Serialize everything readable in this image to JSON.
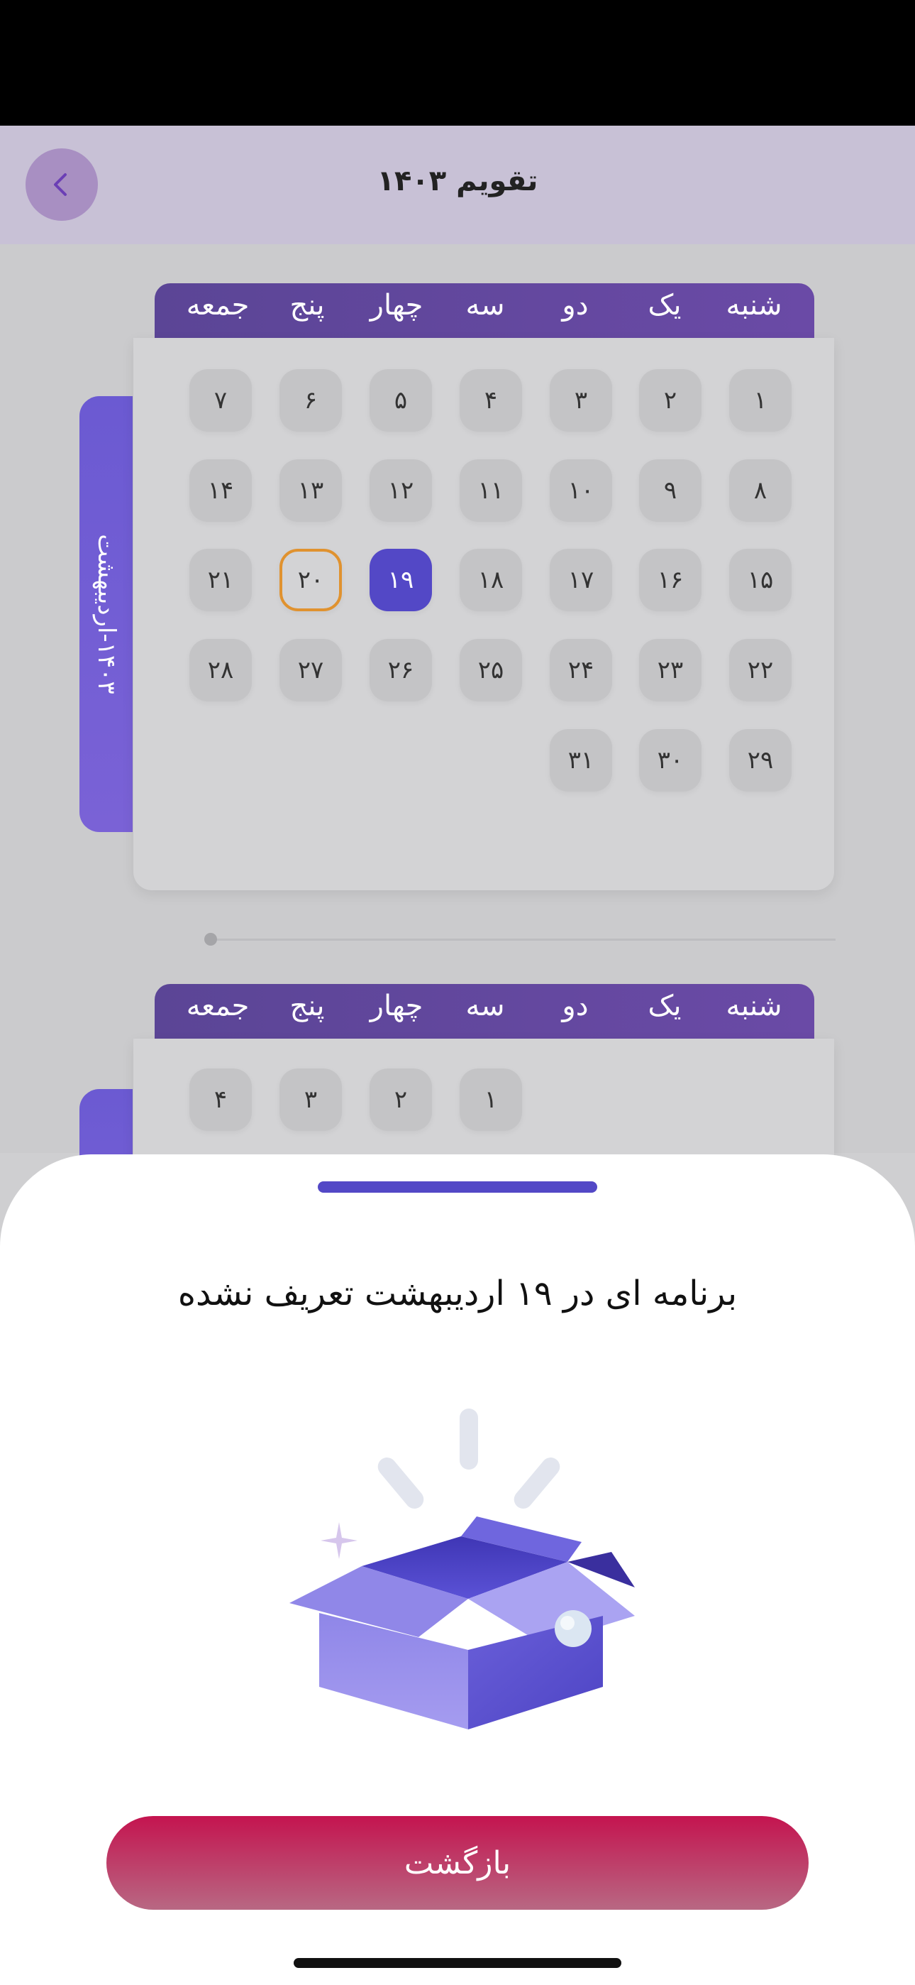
{
  "app": {
    "title": "تقویم ۱۴۰۳"
  },
  "weekdays": [
    "شنبه",
    "یک",
    "دو",
    "سه",
    "چهار",
    "پنج",
    "جمعه"
  ],
  "months": [
    {
      "label": "۱۴۰۳-اردیبهشت",
      "days": [
        [
          "۱",
          "۲",
          "۳",
          "۴",
          "۵",
          "۶",
          "۷"
        ],
        [
          "۸",
          "۹",
          "۱۰",
          "۱۱",
          "۱۲",
          "۱۳",
          "۱۴"
        ],
        [
          "۱۵",
          "۱۶",
          "۱۷",
          "۱۸",
          "۱۹",
          "۲۰",
          "۲۱"
        ],
        [
          "۲۲",
          "۲۳",
          "۲۴",
          "۲۵",
          "۲۶",
          "۲۷",
          "۲۸"
        ],
        [
          "۲۹",
          "۳۰",
          "۳۱",
          "",
          "",
          "",
          ""
        ]
      ],
      "selected": "۱۹",
      "today": "۲۰"
    },
    {
      "days": [
        [
          "",
          "",
          "",
          "۱",
          "۲",
          "۳",
          "۴"
        ]
      ]
    }
  ],
  "sheet": {
    "message": "برنامه ای در ۱۹ اردیبهشت تعریف نشده",
    "back_label": "بازگشت"
  },
  "colors": {
    "accent": "#5348c6",
    "today_ring": "#e0922f",
    "back_button": "#c4144f"
  }
}
